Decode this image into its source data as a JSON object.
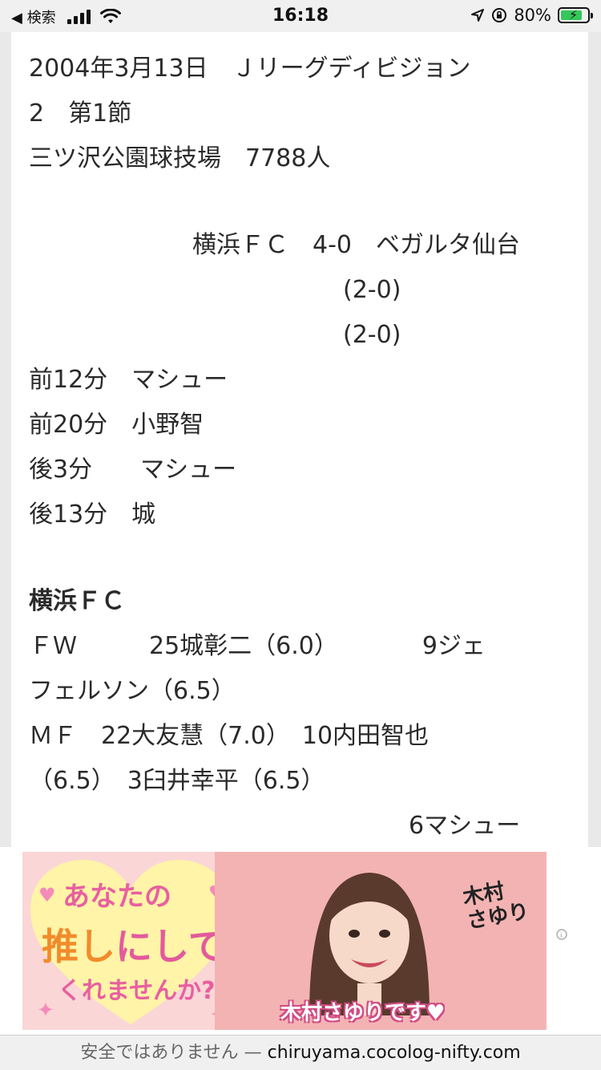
{
  "status_bar": {
    "back_label": "◀ 検索",
    "time": "16:18",
    "battery_percent": "80%",
    "signal_bars": 4
  },
  "article": {
    "lines": [
      "2004年3月13日　Ｊリーグディビジョン",
      "2　第1節",
      "三ツ沢公園球技場　7788人",
      "横浜ＦＣ　4-0　ベガルタ仙台",
      "(2-0)",
      "(2-0)",
      "前12分　マシュー",
      "前20分　小野智",
      "後3分　　マシュー",
      "後13分　城",
      "横浜ＦＣ",
      "ＦＷ　　　25城彰二（6.0）　　　　9ジェ",
      "フェルソン（6.5）",
      "ＭＦ　22大友慧（7.0）　10内田智也",
      "（6.5）　3臼井幸平（6.5）",
      "6マシュー"
    ]
  },
  "ad": {
    "line1": "あなたの",
    "line2a": "推し",
    "line2b": "にして",
    "line3": "くれませんか?",
    "caption": "木村さゆりです♥",
    "signature": "木村\nさゆり"
  },
  "url_bar": {
    "warning": "安全ではありません — ",
    "host": "chiruyama.cocolog-nifty.com"
  },
  "colors": {
    "ad_pink": "#e85fa0",
    "ad_orange": "#f28b2b",
    "battery_green": "#34c759"
  }
}
